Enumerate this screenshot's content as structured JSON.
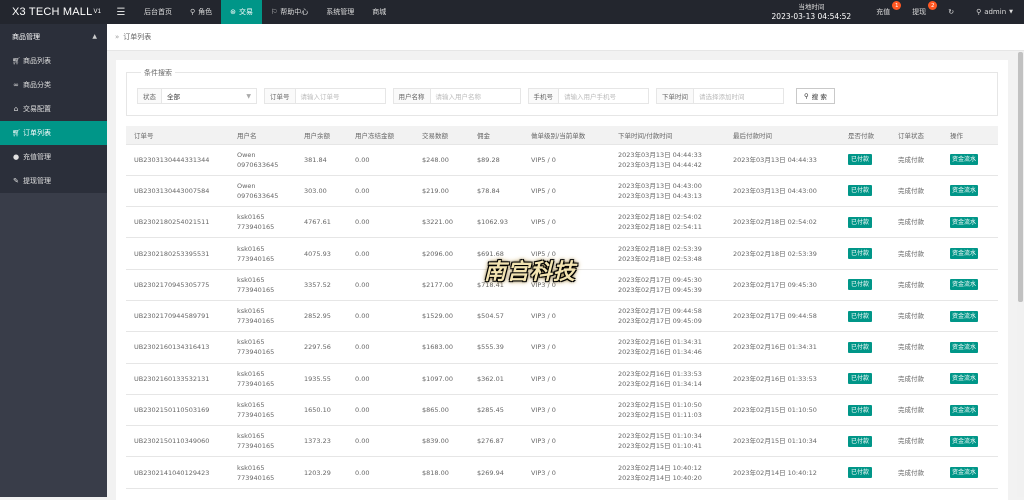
{
  "brand": {
    "name": "X3 TECH MALL",
    "version": "V1"
  },
  "topnav": {
    "items": [
      {
        "label": "后台首页",
        "icon": ""
      },
      {
        "label": "角色",
        "icon": "user-icon"
      },
      {
        "label": "交易",
        "icon": "exchange-icon",
        "active": true
      },
      {
        "label": "帮助中心",
        "icon": "flag-icon"
      },
      {
        "label": "系统管理",
        "icon": ""
      },
      {
        "label": "商城",
        "icon": ""
      }
    ],
    "time_label": "当地时间",
    "time_value": "2023-03-13 04:54:52",
    "recharge_label": "充值",
    "recharge_badge": "1",
    "withdraw_label": "提现",
    "withdraw_badge": "2",
    "user_label": "admin"
  },
  "sidebar": {
    "group_label": "商品管理",
    "items": [
      {
        "label": "商品列表",
        "icon": "cart-icon"
      },
      {
        "label": "商品分类",
        "icon": "link-icon"
      },
      {
        "label": "交易配置",
        "icon": "bank-icon"
      },
      {
        "label": "订单列表",
        "icon": "cart-icon",
        "active": true
      },
      {
        "label": "充值管理",
        "icon": "chat-icon"
      },
      {
        "label": "提现管理",
        "icon": "tool-icon"
      }
    ]
  },
  "breadcrumb": {
    "label": "订单列表"
  },
  "search": {
    "legend": "条件搜索",
    "status_label": "状态",
    "status_value": "全部",
    "order_label": "订单号",
    "order_placeholder": "请输入订单号",
    "username_label": "用户名称",
    "username_placeholder": "请输入用户名称",
    "phone_label": "手机号",
    "phone_placeholder": "请输入用户手机号",
    "time_label": "下单时间",
    "time_placeholder": "请选择添加时间",
    "button_label": "搜 索"
  },
  "table": {
    "headers": [
      "订单号",
      "用户名",
      "用户余额",
      "用户冻结金额",
      "交易数额",
      "佣金",
      "做单级别/当前单数",
      "下单时间/付款时间",
      "最后付款时间",
      "是否付款",
      "订单状态",
      "操作"
    ],
    "rows": [
      {
        "order": "UB2303130444331344",
        "user1": "Owen",
        "user2": "0970633645",
        "balance": "381.84",
        "frozen": "0.00",
        "amount": "$248.00",
        "commission": "$89.28",
        "level": "VIP5 / 0",
        "time1": "2023年03月13日 04:44:33",
        "time2": "2023年03月13日 04:44:42",
        "last": "2023年03月13日 04:44:33",
        "paid": "已付款",
        "status": "完成付款",
        "action": "资金流水"
      },
      {
        "order": "UB2303130443007584",
        "user1": "Owen",
        "user2": "0970633645",
        "balance": "303.00",
        "frozen": "0.00",
        "amount": "$219.00",
        "commission": "$78.84",
        "level": "VIP5 / 0",
        "time1": "2023年03月13日 04:43:00",
        "time2": "2023年03月13日 04:43:13",
        "last": "2023年03月13日 04:43:00",
        "paid": "已付款",
        "status": "完成付款",
        "action": "资金流水"
      },
      {
        "order": "UB2302180254021511",
        "user1": "ksk0165",
        "user2": "773940165",
        "balance": "4767.61",
        "frozen": "0.00",
        "amount": "$3221.00",
        "commission": "$1062.93",
        "level": "VIP5 / 0",
        "time1": "2023年02月18日 02:54:02",
        "time2": "2023年02月18日 02:54:11",
        "last": "2023年02月18日 02:54:02",
        "paid": "已付款",
        "status": "完成付款",
        "action": "资金流水"
      },
      {
        "order": "UB2302180253395531",
        "user1": "ksk0165",
        "user2": "773940165",
        "balance": "4075.93",
        "frozen": "0.00",
        "amount": "$2096.00",
        "commission": "$691.68",
        "level": "VIP5 / 0",
        "time1": "2023年02月18日 02:53:39",
        "time2": "2023年02月18日 02:53:48",
        "last": "2023年02月18日 02:53:39",
        "paid": "已付款",
        "status": "完成付款",
        "action": "资金流水"
      },
      {
        "order": "UB2302170945305775",
        "user1": "ksk0165",
        "user2": "773940165",
        "balance": "3357.52",
        "frozen": "0.00",
        "amount": "$2177.00",
        "commission": "$718.41",
        "level": "VIP3 / 0",
        "time1": "2023年02月17日 09:45:30",
        "time2": "2023年02月17日 09:45:39",
        "last": "2023年02月17日 09:45:30",
        "paid": "已付款",
        "status": "完成付款",
        "action": "资金流水"
      },
      {
        "order": "UB2302170944589791",
        "user1": "ksk0165",
        "user2": "773940165",
        "balance": "2852.95",
        "frozen": "0.00",
        "amount": "$1529.00",
        "commission": "$504.57",
        "level": "VIP3 / 0",
        "time1": "2023年02月17日 09:44:58",
        "time2": "2023年02月17日 09:45:09",
        "last": "2023年02月17日 09:44:58",
        "paid": "已付款",
        "status": "完成付款",
        "action": "资金流水"
      },
      {
        "order": "UB2302160134316413",
        "user1": "ksk0165",
        "user2": "773940165",
        "balance": "2297.56",
        "frozen": "0.00",
        "amount": "$1683.00",
        "commission": "$555.39",
        "level": "VIP3 / 0",
        "time1": "2023年02月16日 01:34:31",
        "time2": "2023年02月16日 01:34:46",
        "last": "2023年02月16日 01:34:31",
        "paid": "已付款",
        "status": "完成付款",
        "action": "资金流水"
      },
      {
        "order": "UB2302160133532131",
        "user1": "ksk0165",
        "user2": "773940165",
        "balance": "1935.55",
        "frozen": "0.00",
        "amount": "$1097.00",
        "commission": "$362.01",
        "level": "VIP3 / 0",
        "time1": "2023年02月16日 01:33:53",
        "time2": "2023年02月16日 01:34:14",
        "last": "2023年02月16日 01:33:53",
        "paid": "已付款",
        "status": "完成付款",
        "action": "资金流水"
      },
      {
        "order": "UB2302150110503169",
        "user1": "ksk0165",
        "user2": "773940165",
        "balance": "1650.10",
        "frozen": "0.00",
        "amount": "$865.00",
        "commission": "$285.45",
        "level": "VIP3 / 0",
        "time1": "2023年02月15日 01:10:50",
        "time2": "2023年02月15日 01:11:03",
        "last": "2023年02月15日 01:10:50",
        "paid": "已付款",
        "status": "完成付款",
        "action": "资金流水"
      },
      {
        "order": "UB2302150110349060",
        "user1": "ksk0165",
        "user2": "773940165",
        "balance": "1373.23",
        "frozen": "0.00",
        "amount": "$839.00",
        "commission": "$276.87",
        "level": "VIP3 / 0",
        "time1": "2023年02月15日 01:10:34",
        "time2": "2023年02月15日 01:10:41",
        "last": "2023年02月15日 01:10:34",
        "paid": "已付款",
        "status": "完成付款",
        "action": "资金流水"
      },
      {
        "order": "UB2302141040129423",
        "user1": "ksk0165",
        "user2": "773940165",
        "balance": "1203.29",
        "frozen": "0.00",
        "amount": "$818.00",
        "commission": "$269.94",
        "level": "VIP3 / 0",
        "time1": "2023年02月14日 10:40:12",
        "time2": "2023年02月14日 10:40:20",
        "last": "2023年02月14日 10:40:12",
        "paid": "已付款",
        "status": "完成付款",
        "action": "资金流水"
      }
    ]
  },
  "watermark": "南宫科技",
  "colors": {
    "accent": "#009688",
    "topbar": "#23262e",
    "sidebar": "#393d49",
    "badge": "#ff5722"
  }
}
